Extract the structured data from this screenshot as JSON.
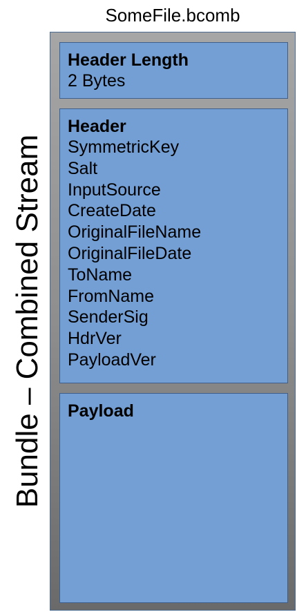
{
  "file_name": "SomeFile.bcomb",
  "stream_label": "Bundle – Combined Stream",
  "colors": {
    "block_fill": "#739fd5",
    "block_border": "#3e5f8c",
    "container_top": "#a6a6a6",
    "container_bottom": "#6a6a6a"
  },
  "header_length": {
    "title": "Header Length",
    "value": "2 Bytes"
  },
  "header": {
    "title": "Header",
    "fields": [
      "SymmetricKey",
      "Salt",
      "InputSource",
      "CreateDate",
      "OriginalFileName",
      "OriginalFileDate",
      "ToName",
      "FromName",
      "SenderSig",
      "HdrVer",
      "PayloadVer"
    ]
  },
  "payload": {
    "title": "Payload"
  }
}
